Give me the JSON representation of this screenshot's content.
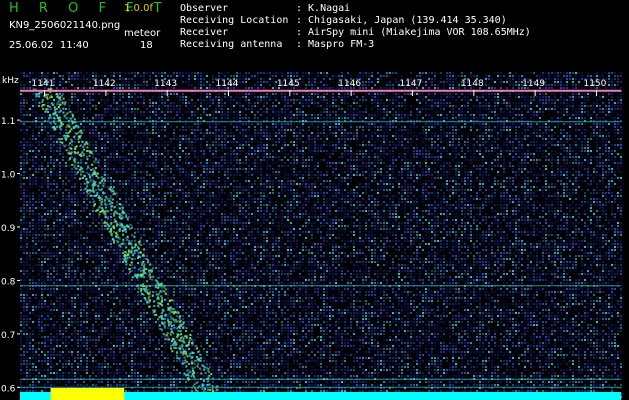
{
  "header": {
    "app_name": "H R O F F T",
    "version": "1.0.0f",
    "filename": "KN9_2506021140.png",
    "meteor_label": "meteor",
    "datetime": "25.06.02  11:40",
    "count": "18",
    "info": [
      {
        "label": "Observer",
        "value": ": K.Nagai"
      },
      {
        "label": "Receiving Location",
        "value": ": Chigasaki, Japan (139.414 35.340)"
      },
      {
        "label": "Receiver",
        "value": ": AirSpy mini (Miakejima VOR 108.65MHz)"
      },
      {
        "label": "Receiving antenna",
        "value": ": Maspro FM-3"
      }
    ]
  },
  "chart_data": {
    "type": "heatmap",
    "ylabel": "kHz",
    "y_ticks": [
      "1.1",
      "1.0",
      "0.9",
      "0.8",
      "0.7",
      "0.6"
    ],
    "y_tick_values": [
      1.1,
      1.0,
      0.9,
      0.8,
      0.7,
      0.6
    ],
    "ylim": [
      0.58,
      1.19
    ],
    "x_ticks": [
      "1141",
      "1142",
      "1143",
      "1144",
      "1145",
      "1146",
      "1147",
      "1148",
      "1149",
      "1150"
    ],
    "x_tick_values": [
      1141,
      1142,
      1143,
      1144,
      1145,
      1146,
      1147,
      1148,
      1149,
      1150
    ],
    "xlim": [
      1140.6,
      1150.4
    ],
    "carrier_lines_khz": [
      1.155,
      1.097,
      0.79,
      0.615,
      0.6
    ],
    "meteor_echo": {
      "time_start": 1141.0,
      "time_end": 1143.7,
      "freq_start": 1.16,
      "freq_end": 0.58
    },
    "colors": {
      "background": "#000000",
      "noise_low": "#0a1a6e",
      "noise_mid": "#2b4fd4",
      "noise_high": "#33d6e6",
      "echo": "#7dde6a",
      "carrier": "#ff80c0",
      "saturation": "#ffff00",
      "bottom_band": "#00ffff"
    }
  }
}
